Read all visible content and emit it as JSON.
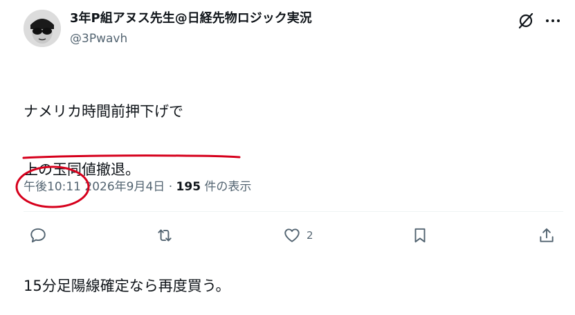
{
  "post": {
    "display_name": "3年P組アヌス先生@日経先物ロジック実況",
    "handle": "@3Pwavh",
    "body_lines": [
      "ナメリカ時間前押下げで",
      "上の玉同値撤退。",
      "",
      "15分足陽線確定なら再度買う。"
    ],
    "time": "午後10:11",
    "date": "2026年9月4日",
    "separator": "·",
    "view_count": "195",
    "view_label": "件の表示"
  },
  "actions": {
    "reply_count": "",
    "repost_count": "",
    "like_count": "2",
    "bookmark_count": ""
  },
  "icons": {
    "avatar": "avatar-sunglasses",
    "grok": "grok-icon",
    "more": "more-icon",
    "reply": "reply-icon",
    "repost": "repost-icon",
    "like": "heart-icon",
    "bookmark": "bookmark-icon",
    "share": "share-icon"
  },
  "colors": {
    "text": "#0f1419",
    "secondary": "#536471",
    "annotation": "#d6001c"
  }
}
